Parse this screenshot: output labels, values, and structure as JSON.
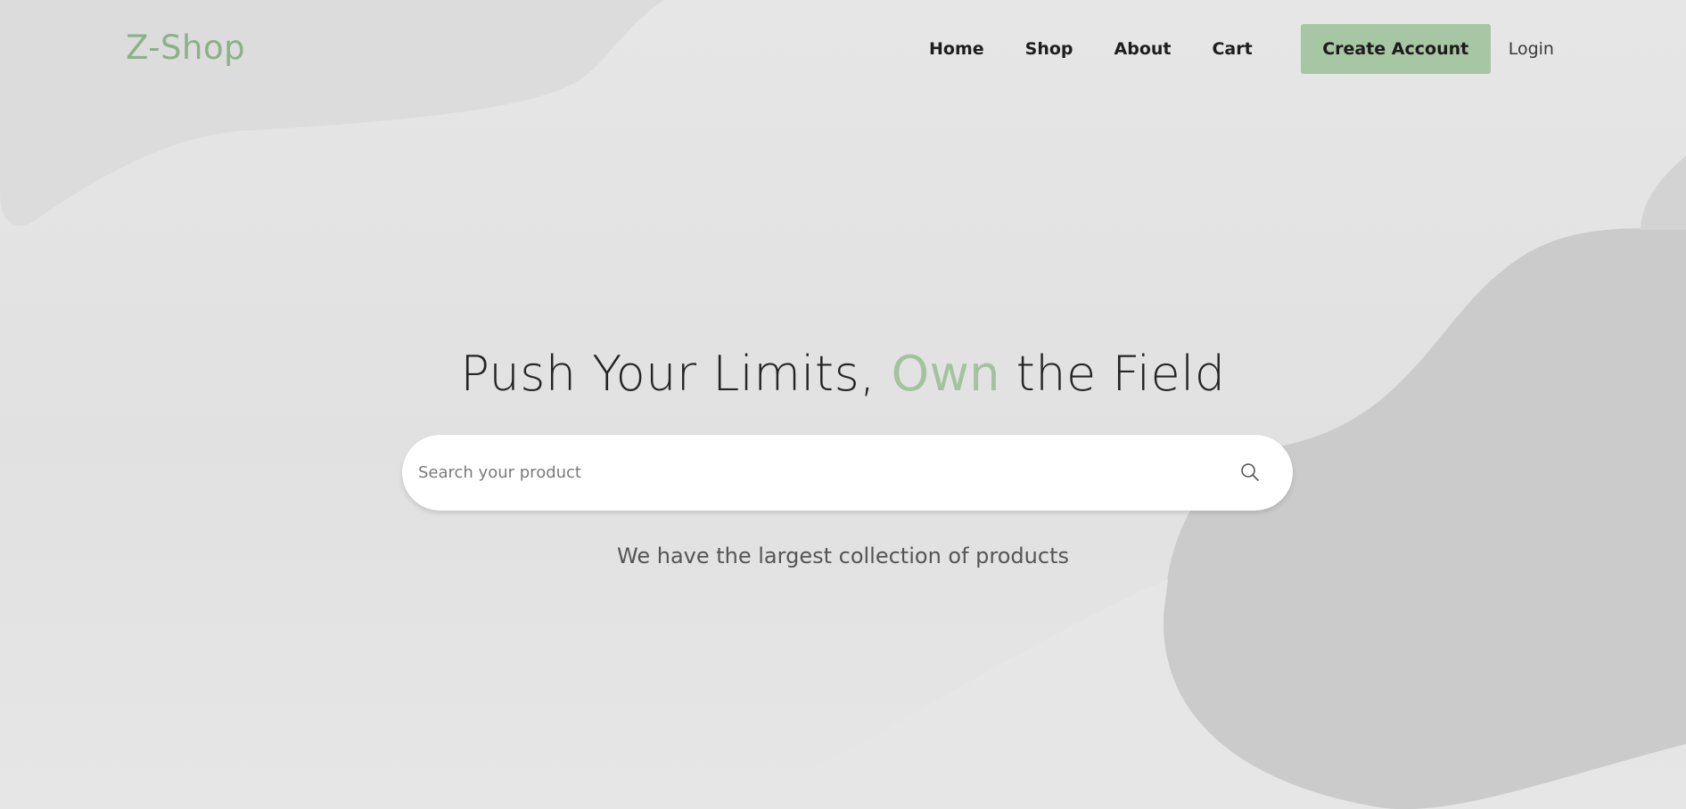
{
  "brand": {
    "logo_text": "Z-Shop",
    "accent_color": "#a7c6a3"
  },
  "nav": {
    "items": [
      {
        "label": "Home"
      },
      {
        "label": "Shop"
      },
      {
        "label": "About"
      },
      {
        "label": "Cart"
      }
    ],
    "create_account_label": "Create Account",
    "login_label": "Login"
  },
  "hero": {
    "title_part1": "Push Your Limits, ",
    "title_accent": "Own",
    "title_part2": " the Field",
    "search": {
      "placeholder": "Search your product",
      "value": "",
      "icon": "search-icon"
    },
    "tagline": "We have the largest collection of products"
  }
}
